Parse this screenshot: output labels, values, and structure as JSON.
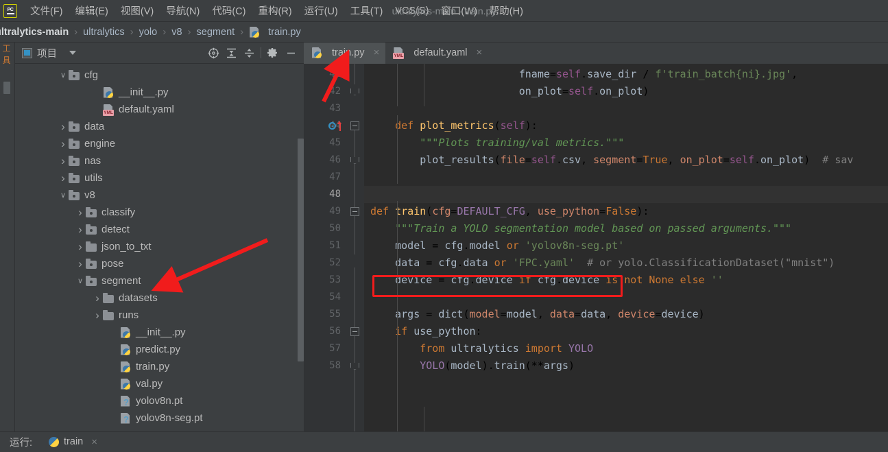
{
  "window": {
    "title": "ultralytics-main - train.py",
    "app_icon": "pycharm-logo-icon"
  },
  "menubar": {
    "items": [
      {
        "label": "文件(F)",
        "name": "menu-file"
      },
      {
        "label": "编辑(E)",
        "name": "menu-edit"
      },
      {
        "label": "视图(V)",
        "name": "menu-view"
      },
      {
        "label": "导航(N)",
        "name": "menu-navigate"
      },
      {
        "label": "代码(C)",
        "name": "menu-code"
      },
      {
        "label": "重构(R)",
        "name": "menu-refactor"
      },
      {
        "label": "运行(U)",
        "name": "menu-run"
      },
      {
        "label": "工具(T)",
        "name": "menu-tools"
      },
      {
        "label": "VCS(S)",
        "name": "menu-vcs"
      },
      {
        "label": "窗口(W)",
        "name": "menu-window"
      },
      {
        "label": "帮助(H)",
        "name": "menu-help"
      }
    ]
  },
  "breadcrumb": {
    "separator": "›",
    "items": [
      "ultralytics-main",
      "ultralytics",
      "yolo",
      "v8",
      "segment",
      "train.py"
    ]
  },
  "project_panel": {
    "tab_label": "项目",
    "toolbar": {
      "locate_icon": "crosshair-target-icon",
      "expand_all_icon": "expand-all-icon",
      "collapse_all_icon": "collapse-all-icon",
      "settings_icon": "gear-icon",
      "hide_icon": "minimize-icon"
    },
    "tree": [
      {
        "label": "cfg",
        "indent": 1,
        "arrow": "down",
        "icon": "folder-package-icon"
      },
      {
        "label": "__init__.py",
        "indent": 3,
        "arrow": "none",
        "icon": "python-file-icon"
      },
      {
        "label": "default.yaml",
        "indent": 3,
        "arrow": "none",
        "icon": "yaml-file-icon"
      },
      {
        "label": "data",
        "indent": 1,
        "arrow": "right",
        "icon": "folder-package-icon"
      },
      {
        "label": "engine",
        "indent": 1,
        "arrow": "right",
        "icon": "folder-package-icon"
      },
      {
        "label": "nas",
        "indent": 1,
        "arrow": "right",
        "icon": "folder-package-icon"
      },
      {
        "label": "utils",
        "indent": 1,
        "arrow": "right",
        "icon": "folder-package-icon"
      },
      {
        "label": "v8",
        "indent": 1,
        "arrow": "down",
        "icon": "folder-package-icon"
      },
      {
        "label": "classify",
        "indent": 2,
        "arrow": "right",
        "icon": "folder-package-icon"
      },
      {
        "label": "detect",
        "indent": 2,
        "arrow": "right",
        "icon": "folder-package-icon"
      },
      {
        "label": "json_to_txt",
        "indent": 2,
        "arrow": "right",
        "icon": "folder-icon"
      },
      {
        "label": "pose",
        "indent": 2,
        "arrow": "right",
        "icon": "folder-package-icon"
      },
      {
        "label": "segment",
        "indent": 2,
        "arrow": "down",
        "icon": "folder-package-icon"
      },
      {
        "label": "datasets",
        "indent": 3,
        "arrow": "right",
        "icon": "folder-icon"
      },
      {
        "label": "runs",
        "indent": 3,
        "arrow": "right",
        "icon": "folder-icon"
      },
      {
        "label": "__init__.py",
        "indent": 4,
        "arrow": "none",
        "icon": "python-file-icon"
      },
      {
        "label": "predict.py",
        "indent": 4,
        "arrow": "none",
        "icon": "python-file-icon"
      },
      {
        "label": "train.py",
        "indent": 4,
        "arrow": "none",
        "icon": "python-file-icon"
      },
      {
        "label": "val.py",
        "indent": 4,
        "arrow": "none",
        "icon": "python-file-icon"
      },
      {
        "label": "yolov8n.pt",
        "indent": 4,
        "arrow": "none",
        "icon": "unknown-file-icon"
      },
      {
        "label": "yolov8n-seg.pt",
        "indent": 4,
        "arrow": "none",
        "icon": "unknown-file-icon"
      }
    ]
  },
  "editor": {
    "tabs": [
      {
        "label": "train.py",
        "icon": "python-file-icon",
        "active": true,
        "close": "×"
      },
      {
        "label": "default.yaml",
        "icon": "yaml-file-icon",
        "active": false,
        "close": "×"
      }
    ],
    "first_line_number": 41,
    "current_line": 48,
    "gutter_marker_line": 44,
    "gutter_marker_icon": "overriding-method-icon",
    "lines": [
      {
        "n": 41,
        "text": "                        fname=self.save_dir / f'train_batch{ni}.jpg',"
      },
      {
        "n": 42,
        "text": "                        on_plot=self.on_plot)"
      },
      {
        "n": 43,
        "text": ""
      },
      {
        "n": 44,
        "text": "    def plot_metrics(self):"
      },
      {
        "n": 45,
        "text": "        \"\"\"Plots training/val metrics.\"\"\""
      },
      {
        "n": 46,
        "text": "        plot_results(file=self.csv, segment=True, on_plot=self.on_plot)  # sav"
      },
      {
        "n": 47,
        "text": ""
      },
      {
        "n": 48,
        "text": ""
      },
      {
        "n": 49,
        "text": "def train(cfg=DEFAULT_CFG, use_python=False):"
      },
      {
        "n": 50,
        "text": "    \"\"\"Train a YOLO segmentation model based on passed arguments.\"\"\""
      },
      {
        "n": 51,
        "text": "    model = cfg.model or 'yolov8n-seg.pt'"
      },
      {
        "n": 52,
        "text": "    data = cfg.data or 'FPC.yaml'  # or yolo.ClassificationDataset(\"mnist\")"
      },
      {
        "n": 53,
        "text": "    device = cfg.device if cfg.device is not None else ''"
      },
      {
        "n": 54,
        "text": ""
      },
      {
        "n": 55,
        "text": "    args = dict(model=model, data=data, device=device)"
      },
      {
        "n": 56,
        "text": "    if use_python:"
      },
      {
        "n": 57,
        "text": "        from ultralytics import YOLO"
      },
      {
        "n": 58,
        "text": "        YOLO(model).train(**args)"
      }
    ]
  },
  "annotations": {
    "highlight_color": "#f11c1c",
    "red_box_target": "line 52: data = cfg.data or 'FPC.yaml'  # or",
    "arrow_1_target": "train.py editor tab",
    "arrow_2_target": "segment folder in project tree"
  },
  "statusbar": {
    "run_label": "运行:",
    "run_config": "train",
    "run_icon": "python-icon",
    "close": "×"
  },
  "edge_strip": {
    "vertical_text": "工 具",
    "chip": "tool-window-stripe"
  },
  "colors": {
    "chrome_bg": "#3c3f41",
    "editor_bg": "#2b2b2b",
    "gutter_bg": "#313335",
    "text": "#bbbbbb",
    "keyword": "#cc7832",
    "string": "#6a8759",
    "docstring": "#629755",
    "function": "#ffc66d",
    "self": "#94558d",
    "param": "#d0866a",
    "comment": "#808080",
    "accent_red": "#f11c1c",
    "accent_blue": "#3592c4"
  }
}
